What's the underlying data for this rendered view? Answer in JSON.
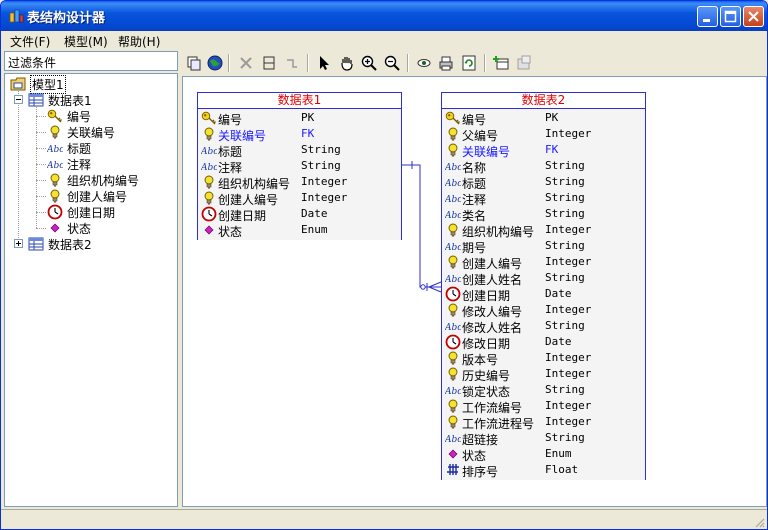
{
  "window": {
    "title": "表结构设计器"
  },
  "menu": [
    {
      "label": "文件(F)"
    },
    {
      "label": "模型(M)"
    },
    {
      "label": "帮助(H)"
    }
  ],
  "filter": {
    "placeholder": "过滤条件"
  },
  "tree": {
    "root": "模型1",
    "tables": [
      {
        "name": "数据表1",
        "expanded": true,
        "fields": [
          {
            "name": "编号",
            "icon": "key-icon"
          },
          {
            "name": "关联编号",
            "icon": "bulb-icon"
          },
          {
            "name": "标题",
            "icon": "abc-icon"
          },
          {
            "name": "注释",
            "icon": "abc-icon"
          },
          {
            "name": "组织机构编号",
            "icon": "bulb-icon"
          },
          {
            "name": "创建人编号",
            "icon": "bulb-icon"
          },
          {
            "name": "创建日期",
            "icon": "clock-icon"
          },
          {
            "name": "状态",
            "icon": "diamond-icon"
          }
        ]
      },
      {
        "name": "数据表2",
        "expanded": false
      }
    ]
  },
  "entities": [
    {
      "title": "数据表1",
      "fields": [
        {
          "name": "编号",
          "type": "PK",
          "icon": "key-icon",
          "fk": false
        },
        {
          "name": "关联编号",
          "type": "FK",
          "icon": "bulb-icon",
          "fk": true
        },
        {
          "name": "标题",
          "type": "String",
          "icon": "abc-icon",
          "fk": false
        },
        {
          "name": "注释",
          "type": "String",
          "icon": "abc-icon",
          "fk": false
        },
        {
          "name": "组织机构编号",
          "type": "Integer",
          "icon": "bulb-icon",
          "fk": false
        },
        {
          "name": "创建人编号",
          "type": "Integer",
          "icon": "bulb-icon",
          "fk": false
        },
        {
          "name": "创建日期",
          "type": "Date",
          "icon": "clock-icon",
          "fk": false
        },
        {
          "name": "状态",
          "type": "Enum",
          "icon": "diamond-icon",
          "fk": false
        }
      ]
    },
    {
      "title": "数据表2",
      "fields": [
        {
          "name": "编号",
          "type": "PK",
          "icon": "key-icon",
          "fk": false
        },
        {
          "name": "父编号",
          "type": "Integer",
          "icon": "bulb-icon",
          "fk": false
        },
        {
          "name": "关联编号",
          "type": "FK",
          "icon": "bulb-icon",
          "fk": true
        },
        {
          "name": "名称",
          "type": "String",
          "icon": "abc-icon",
          "fk": false
        },
        {
          "name": "标题",
          "type": "String",
          "icon": "abc-icon",
          "fk": false
        },
        {
          "name": "注释",
          "type": "String",
          "icon": "abc-icon",
          "fk": false
        },
        {
          "name": "类名",
          "type": "String",
          "icon": "abc-icon",
          "fk": false
        },
        {
          "name": "组织机构编号",
          "type": "Integer",
          "icon": "bulb-icon",
          "fk": false
        },
        {
          "name": "期号",
          "type": "String",
          "icon": "abc-icon",
          "fk": false
        },
        {
          "name": "创建人编号",
          "type": "Integer",
          "icon": "bulb-icon",
          "fk": false
        },
        {
          "name": "创建人姓名",
          "type": "String",
          "icon": "abc-icon",
          "fk": false
        },
        {
          "name": "创建日期",
          "type": "Date",
          "icon": "clock-icon",
          "fk": false
        },
        {
          "name": "修改人编号",
          "type": "Integer",
          "icon": "bulb-icon",
          "fk": false
        },
        {
          "name": "修改人姓名",
          "type": "String",
          "icon": "abc-icon",
          "fk": false
        },
        {
          "name": "修改日期",
          "type": "Date",
          "icon": "clock-icon",
          "fk": false
        },
        {
          "name": "版本号",
          "type": "Integer",
          "icon": "bulb-icon",
          "fk": false
        },
        {
          "name": "历史编号",
          "type": "Integer",
          "icon": "bulb-icon",
          "fk": false
        },
        {
          "name": "锁定状态",
          "type": "String",
          "icon": "abc-icon",
          "fk": false
        },
        {
          "name": "工作流编号",
          "type": "Integer",
          "icon": "bulb-icon",
          "fk": false
        },
        {
          "name": "工作流进程号",
          "type": "Integer",
          "icon": "bulb-icon",
          "fk": false
        },
        {
          "name": "超链接",
          "type": "String",
          "icon": "abc-icon",
          "fk": false
        },
        {
          "name": "状态",
          "type": "Enum",
          "icon": "diamond-icon",
          "fk": false
        },
        {
          "name": "排序号",
          "type": "Float",
          "icon": "hash-icon",
          "fk": false
        }
      ]
    }
  ],
  "toolbar": [
    "copy-icon",
    "globe-icon",
    "delete-icon",
    "frame-icon",
    "connector-icon",
    "pointer-icon",
    "hand-icon",
    "zoom-in-icon",
    "zoom-out-icon",
    "view-icon",
    "print-icon",
    "refresh-icon",
    "add-table-icon",
    "properties-icon"
  ],
  "colors": {
    "entity_border": "#2f2fcf",
    "entity_title": "#e00000",
    "fk_text": "#1a1aff"
  }
}
